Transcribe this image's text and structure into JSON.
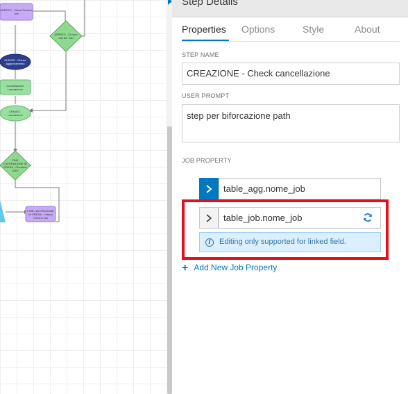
{
  "canvas": {
    "nodes": [
      {
        "id": "n1",
        "text": "APERTO - Chiusi Termine Job"
      },
      {
        "id": "n2",
        "text": "APERTO - Ci sono 'Job da' 'Job'"
      },
      {
        "id": "n3",
        "text": "CHIUSO - Chiuso Aggiornamento"
      },
      {
        "id": "n4",
        "text": "Cancellazione Lavorazione"
      },
      {
        "id": "n5",
        "text": "CHIUSO - Lavorazione"
      },
      {
        "id": "n6",
        "text": "FINE LAVORAZIONE IN PRESA - Chiudere JOB?"
      },
      {
        "id": "n7",
        "text": "FINE LAVORAZIONE IN PRESA - Lettura Termine Job"
      }
    ]
  },
  "panel": {
    "title": "Step Details",
    "tabs": [
      {
        "label": "Properties",
        "active": true
      },
      {
        "label": "Options",
        "active": false
      },
      {
        "label": "Style",
        "active": false
      },
      {
        "label": "About",
        "active": false
      }
    ],
    "step_name": {
      "label": "STEP NAME",
      "value": "CREAZIONE - Check cancellazione"
    },
    "user_prompt": {
      "label": "USER PROMPT",
      "value": "step per biforcazione path"
    },
    "job_property": {
      "label": "JOB PROPERTY",
      "items": [
        {
          "field": "table_agg.nome_job",
          "expanded": true
        },
        {
          "field": "table_job.nome_job",
          "expanded": false
        }
      ],
      "notice": "Editing only supported for linked field.",
      "add_label": "Add New Job Property"
    }
  },
  "colors": {
    "accent": "#0079c1",
    "highlight": "#e1121b",
    "notice_bg": "#dcefff"
  },
  "icons": [
    "collapse-caret-icon",
    "chevron-right-icon",
    "refresh-icon",
    "info-icon",
    "plus-icon"
  ]
}
